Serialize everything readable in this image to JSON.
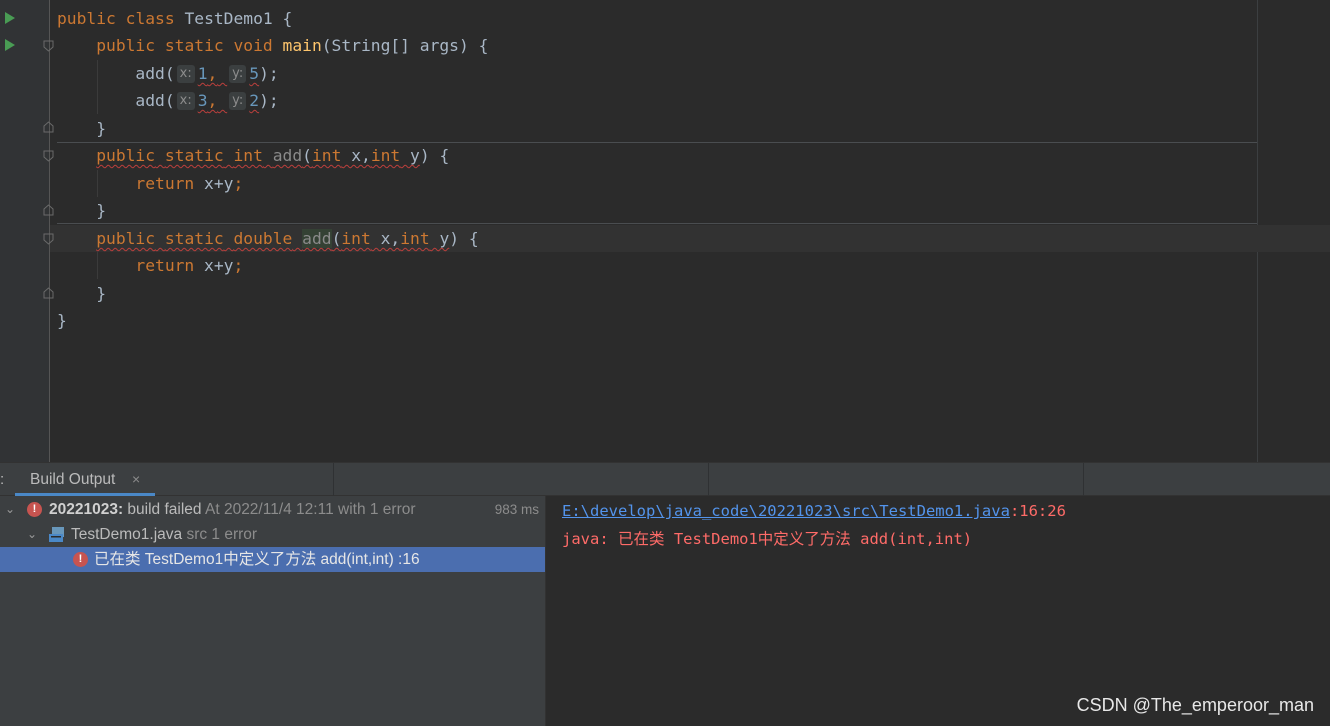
{
  "editor": {
    "class_line": {
      "kw1": "public",
      "kw2": "class",
      "name": "TestDemo1",
      "brace": "{"
    },
    "main_sig": {
      "kw1": "public",
      "kw2": "static",
      "kw3": "void",
      "name": "main",
      "params": "(String[] args) {"
    },
    "call1": {
      "fn": "add(",
      "hint_x": "x:",
      "arg1": "1",
      "comma": ",",
      "hint_y": "y:",
      "arg2": "5",
      "end": ");"
    },
    "call2": {
      "fn": "add(",
      "hint_x": "x:",
      "arg1": "3",
      "comma": ",",
      "hint_y": "y:",
      "arg2": "2",
      "end": ");"
    },
    "main_close": "}",
    "add_int_sig": {
      "kw1": "public",
      "kw2": "static",
      "kw3": "int",
      "name": "add",
      "paren": "(",
      "t1": "int",
      "p1": " x,",
      "t2": "int",
      "p2": " y",
      "end": ") {"
    },
    "add_int_body": {
      "kw": "return",
      "expr": " x+y",
      "semi": ";"
    },
    "add_int_close": "}",
    "add_double_sig": {
      "kw1": "public",
      "kw2": "static",
      "kw3": "double",
      "name": "add",
      "paren": "(",
      "t1": "int",
      "p1": " x,",
      "t2": "int",
      "p2": " y",
      "end": ") {"
    },
    "add_double_body": {
      "kw": "return",
      "expr": " x+y",
      "semi": ";"
    },
    "add_double_close": "}",
    "class_close": "}"
  },
  "tool_window": {
    "prefix": ":",
    "tab_label": "Build Output",
    "tab_close": "×"
  },
  "build_tree": {
    "root": {
      "project": "20221023:",
      "status": " build failed",
      "detail": " At 2022/11/4 12:11 with 1 error",
      "duration": "983 ms"
    },
    "file": {
      "name": "TestDemo1.java",
      "detail": " src 1 error"
    },
    "error": {
      "message": "已在类 TestDemo1中定义了方法 add(int,int) :16"
    }
  },
  "console": {
    "path": "E:\\develop\\java_code\\20221023\\src\\TestDemo1.java",
    "location": ":16:26",
    "message": "java: 已在类 TestDemo1中定义了方法 add(int,int)"
  },
  "watermark": "CSDN @The_emperoor_man",
  "colors": {
    "editor_bg": "#2b2b2b",
    "keyword": "#cc7832",
    "method": "#ffc66d",
    "number": "#6897bb",
    "error": "#ff6b68",
    "link": "#5394ec",
    "selection": "#4b6eaf"
  }
}
